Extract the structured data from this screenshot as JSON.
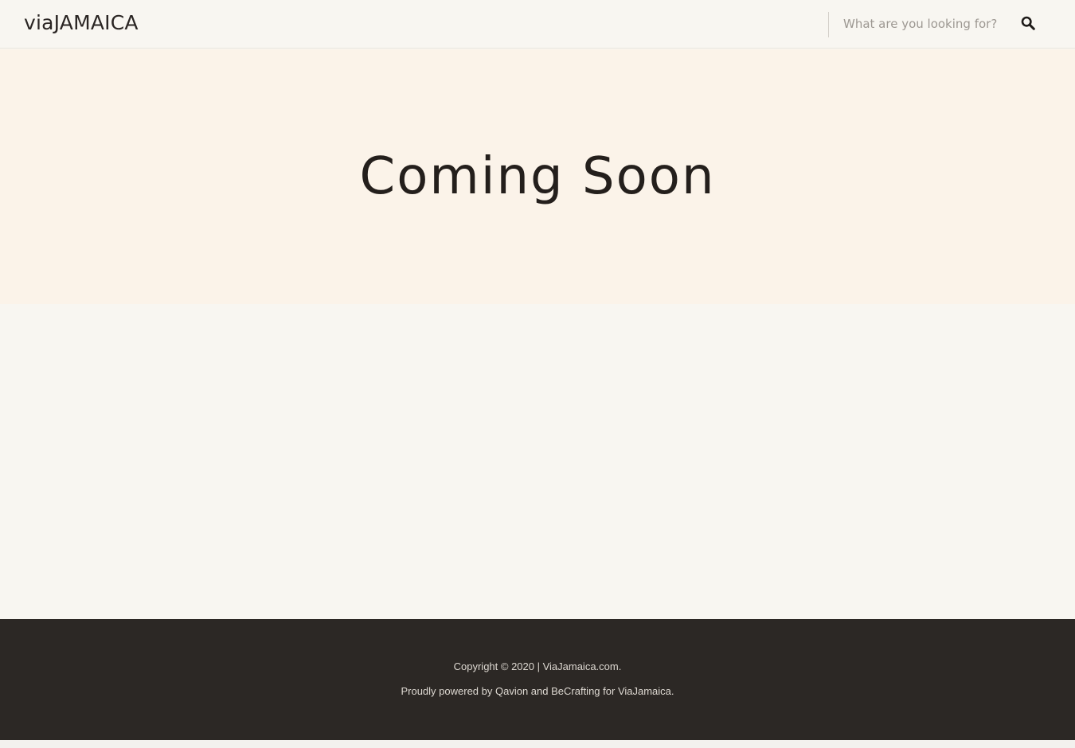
{
  "header": {
    "logo_text": "viaJAMAICA",
    "search": {
      "placeholder": "What are you looking for?",
      "value": "",
      "button_icon": "search-icon"
    }
  },
  "hero": {
    "title": "Coming Soon"
  },
  "footer": {
    "copyright_prefix": "Copyright © 2020 | ",
    "copyright_link": "ViaJamaica.com",
    "copyright_suffix": ".",
    "powered_prefix": "Proudly powered by ",
    "powered_link_1": "Qavion",
    "powered_and": " and ",
    "powered_link_2": "BeCrafting",
    "powered_for": " for ",
    "powered_link_3": "ViaJamaica",
    "powered_suffix": "."
  },
  "colors": {
    "page_background": "#f8f6f1",
    "hero_background": "#fbf3e9",
    "footer_background": "#2c2825",
    "text_dark": "#241f1c",
    "footer_text": "#ddd8d1"
  }
}
